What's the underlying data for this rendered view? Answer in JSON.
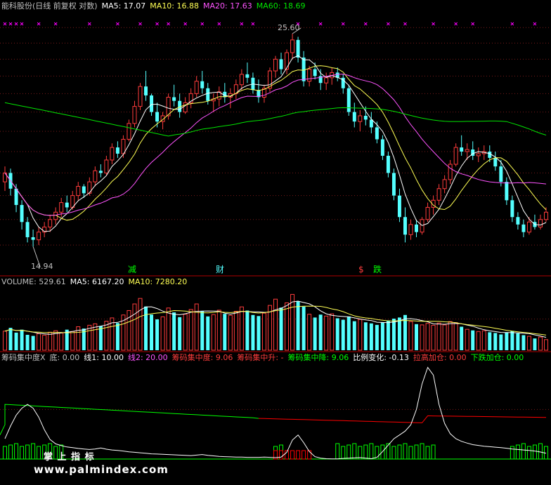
{
  "header": {
    "main": {
      "stock": "能科股份(日线 前复权 对数)",
      "ma5": "MA5: 17.07",
      "ma10": "MA10: 16.88",
      "ma20": "MA20: 17.63",
      "ma60": "MA60: 18.69"
    },
    "volume": {
      "vol": "VOLUME: 529.61",
      "ma5": "MA5: 6167.20",
      "ma10": "MA10: 7280.20"
    },
    "indicator": {
      "name": "筹码集中度X",
      "di": "底: 0.00",
      "xian1": "线1: 10.00",
      "xian2": "线2: 20.00",
      "cmjzd": "筹码集中度: 9.06",
      "rise": "筹码集中升: -",
      "fall": "筹码集中降: 9.06",
      "ratio": "比例变化: -0.13",
      "lagao": "拉高加仓: 0.00",
      "xiadie": "下跌加仓: 0.00"
    }
  },
  "annotations": {
    "high": "25.60",
    "low": "14.94",
    "jian": "减",
    "cai": "财",
    "dollar": "$",
    "die": "跌"
  },
  "watermark": {
    "title": "掌 上 指 标",
    "url": "www.palmindex.com"
  },
  "colors": {
    "up": "#ff3c3c",
    "down": "#54ffff",
    "ma5": "#ffffff",
    "ma10": "#ffff54",
    "ma20": "#ff54ff",
    "ma60": "#00e600",
    "indicator_line": "#ffffff",
    "ind_green": "#00ff00",
    "ind_red": "#ff0000"
  },
  "chart_data": [
    {
      "type": "candlestick",
      "scale": "log",
      "ylim": [
        14.0,
        27.0
      ],
      "high_label": 25.6,
      "low_label": 14.94,
      "bars": [
        [
          17.6,
          18.3,
          17.2,
          18.0
        ],
        [
          18.0,
          18.2,
          17.0,
          17.3
        ],
        [
          17.3,
          17.5,
          16.3,
          16.6
        ],
        [
          16.6,
          16.8,
          15.6,
          15.9
        ],
        [
          15.9,
          16.1,
          15.1,
          15.3
        ],
        [
          15.3,
          15.6,
          14.94,
          15.2
        ],
        [
          15.2,
          15.7,
          15.0,
          15.5
        ],
        [
          15.5,
          15.9,
          15.3,
          15.7
        ],
        [
          15.7,
          16.2,
          15.5,
          16.0
        ],
        [
          16.0,
          16.5,
          15.8,
          16.3
        ],
        [
          16.3,
          16.9,
          16.1,
          16.7
        ],
        [
          16.7,
          17.0,
          16.3,
          16.5
        ],
        [
          16.5,
          17.2,
          16.4,
          17.0
        ],
        [
          17.0,
          17.6,
          16.8,
          17.4
        ],
        [
          17.4,
          17.5,
          16.9,
          17.1
        ],
        [
          17.1,
          17.8,
          17.0,
          17.6
        ],
        [
          17.6,
          18.3,
          17.4,
          18.1
        ],
        [
          18.1,
          18.4,
          17.8,
          18.0
        ],
        [
          18.0,
          18.8,
          17.9,
          18.6
        ],
        [
          18.6,
          19.4,
          18.4,
          19.2
        ],
        [
          19.2,
          19.5,
          18.7,
          18.9
        ],
        [
          18.9,
          19.8,
          18.7,
          19.6
        ],
        [
          19.6,
          20.6,
          19.5,
          20.4
        ],
        [
          20.4,
          21.6,
          20.2,
          21.3
        ],
        [
          21.3,
          22.6,
          21.1,
          22.4
        ],
        [
          22.4,
          23.3,
          21.6,
          21.9
        ],
        [
          21.9,
          22.0,
          20.8,
          21.0
        ],
        [
          21.0,
          21.5,
          20.2,
          20.5
        ],
        [
          20.5,
          21.0,
          20.1,
          20.8
        ],
        [
          20.8,
          22.0,
          20.6,
          21.8
        ],
        [
          21.8,
          22.5,
          21.3,
          21.6
        ],
        [
          21.6,
          22.0,
          20.7,
          21.0
        ],
        [
          21.0,
          21.8,
          20.9,
          21.5
        ],
        [
          21.5,
          22.3,
          21.2,
          22.0
        ],
        [
          22.0,
          23.0,
          21.8,
          22.7
        ],
        [
          22.7,
          23.3,
          22.0,
          22.3
        ],
        [
          22.3,
          22.6,
          21.4,
          21.6
        ],
        [
          21.6,
          22.0,
          21.0,
          21.7
        ],
        [
          21.7,
          22.4,
          21.3,
          22.1
        ],
        [
          22.1,
          22.6,
          21.5,
          21.8
        ],
        [
          21.8,
          22.3,
          21.2,
          22.0
        ],
        [
          22.0,
          22.8,
          21.7,
          22.5
        ],
        [
          22.5,
          23.4,
          22.2,
          23.1
        ],
        [
          23.1,
          23.8,
          22.6,
          22.9
        ],
        [
          22.9,
          23.2,
          22.0,
          22.2
        ],
        [
          22.2,
          22.8,
          21.5,
          21.8
        ],
        [
          21.8,
          22.5,
          21.5,
          22.3
        ],
        [
          22.3,
          23.5,
          22.1,
          23.3
        ],
        [
          23.3,
          24.2,
          22.9,
          24.0
        ],
        [
          24.0,
          24.4,
          23.1,
          23.4
        ],
        [
          23.4,
          24.6,
          23.1,
          24.4
        ],
        [
          24.4,
          25.6,
          24.0,
          25.2
        ],
        [
          25.2,
          25.4,
          23.8,
          24.1
        ],
        [
          24.1,
          24.5,
          22.4,
          22.7
        ],
        [
          22.7,
          23.6,
          22.4,
          23.4
        ],
        [
          23.4,
          23.8,
          22.8,
          23.0
        ],
        [
          23.0,
          23.4,
          22.2,
          22.6
        ],
        [
          22.6,
          23.2,
          22.2,
          22.9
        ],
        [
          22.9,
          23.5,
          22.5,
          23.2
        ],
        [
          23.2,
          23.5,
          22.7,
          22.9
        ],
        [
          22.9,
          23.1,
          22.0,
          22.3
        ],
        [
          22.3,
          22.5,
          20.8,
          21.0
        ],
        [
          21.0,
          21.5,
          20.2,
          20.5
        ],
        [
          20.5,
          21.1,
          20.0,
          20.8
        ],
        [
          20.8,
          21.3,
          20.3,
          20.6
        ],
        [
          20.6,
          21.0,
          19.9,
          20.2
        ],
        [
          20.2,
          20.5,
          19.4,
          19.6
        ],
        [
          19.6,
          19.8,
          18.6,
          18.8
        ],
        [
          18.8,
          19.0,
          17.8,
          18.0
        ],
        [
          18.0,
          18.2,
          16.8,
          17.0
        ],
        [
          17.0,
          17.3,
          15.9,
          16.1
        ],
        [
          16.1,
          16.5,
          15.1,
          15.4
        ],
        [
          15.4,
          16.0,
          15.2,
          15.8
        ],
        [
          15.8,
          16.0,
          15.3,
          15.5
        ],
        [
          15.5,
          16.1,
          15.4,
          16.0
        ],
        [
          16.0,
          16.7,
          15.9,
          16.5
        ],
        [
          16.5,
          17.0,
          16.2,
          16.8
        ],
        [
          16.8,
          17.5,
          16.6,
          17.3
        ],
        [
          17.3,
          17.9,
          17.1,
          17.7
        ],
        [
          17.7,
          18.6,
          17.5,
          18.4
        ],
        [
          18.4,
          19.4,
          18.3,
          19.2
        ],
        [
          19.2,
          19.8,
          18.8,
          19.0
        ],
        [
          19.0,
          19.4,
          18.6,
          19.1
        ],
        [
          19.1,
          19.5,
          18.6,
          18.8
        ],
        [
          18.8,
          19.2,
          18.5,
          18.9
        ],
        [
          18.9,
          19.3,
          18.6,
          19.0
        ],
        [
          19.0,
          19.3,
          18.5,
          18.7
        ],
        [
          18.7,
          19.0,
          18.1,
          18.3
        ],
        [
          18.3,
          18.6,
          17.4,
          17.6
        ],
        [
          17.6,
          17.8,
          16.6,
          16.8
        ],
        [
          16.8,
          17.0,
          15.9,
          16.1
        ],
        [
          16.1,
          16.3,
          15.6,
          15.8
        ],
        [
          15.8,
          16.0,
          15.3,
          15.5
        ],
        [
          15.5,
          16.1,
          15.4,
          15.9
        ],
        [
          15.9,
          16.2,
          15.6,
          15.7
        ],
        [
          15.7,
          16.2,
          15.6,
          16.0
        ],
        [
          16.0,
          16.5,
          15.9,
          16.3
        ]
      ],
      "ma5": "MA5",
      "ma10": "MA10",
      "ma20": "MA20",
      "ma60": "MA60"
    },
    {
      "type": "bar",
      "series": "VOLUME",
      "values": [
        5200,
        6100,
        4800,
        5600,
        4200,
        3900,
        4500,
        4100,
        4900,
        5300,
        4700,
        5600,
        5100,
        6400,
        5900,
        6800,
        7200,
        6600,
        7900,
        8800,
        7400,
        9600,
        10800,
        12600,
        14100,
        11900,
        9700,
        8400,
        9100,
        11500,
        10300,
        9000,
        9800,
        11100,
        12600,
        10700,
        9200,
        9700,
        10900,
        9900,
        9500,
        10600,
        11800,
        10800,
        9600,
        9300,
        10100,
        12200,
        13900,
        11600,
        12900,
        15200,
        13300,
        11900,
        9800,
        8900,
        9700,
        9300,
        9900,
        8700,
        8300,
        9200,
        7900,
        8400,
        7600,
        7300,
        6900,
        7600,
        8100,
        8600,
        8900,
        9600,
        7800,
        7100,
        6900,
        7300,
        6800,
        7400,
        6900,
        7800,
        7500,
        6400,
        5700,
        5400,
        5100,
        5300,
        4900,
        4700,
        4300,
        4900,
        5200,
        4600,
        4100,
        3800,
        3200,
        3600,
        2900
      ],
      "ylim": [
        0,
        17000
      ]
    },
    {
      "type": "line",
      "series_line": "筹码集中度",
      "values": [
        8.5,
        13.5,
        17.8,
        20.5,
        22.0,
        20.5,
        17.0,
        12.0,
        8.2,
        6.5,
        5.8,
        5.3,
        5.0,
        4.7,
        4.5,
        4.3,
        4.5,
        4.9,
        4.4,
        4.1,
        3.9,
        3.7,
        3.4,
        3.2,
        3.0,
        2.8,
        2.6,
        2.5,
        2.4,
        2.3,
        2.2,
        2.1,
        2.0,
        1.9,
        2.1,
        2.3,
        2.0,
        1.8,
        1.6,
        1.5,
        1.4,
        1.3,
        1.3,
        1.2,
        1.2,
        1.2,
        1.3,
        1.2,
        1.1,
        1.3,
        3.2,
        8.0,
        10.0,
        7.0,
        3.5,
        1.5,
        0.9,
        0.7,
        0.6,
        0.6,
        0.8,
        0.9,
        1.0,
        1.1,
        0.9,
        0.7,
        1.2,
        3.5,
        6.0,
        8.5,
        10.0,
        11.5,
        14.0,
        20.0,
        30.0,
        36.5,
        33.5,
        22.0,
        14.5,
        10.5,
        8.5,
        7.5,
        6.8,
        6.2,
        5.9,
        5.6,
        5.4,
        5.2,
        5.0,
        4.8,
        4.5,
        4.3,
        4.1,
        3.9,
        3.7,
        3.3,
        2.8
      ],
      "green_bars": [
        0,
        1,
        2,
        3,
        4,
        5,
        6,
        7,
        8,
        9,
        10,
        48,
        49,
        59,
        60,
        61,
        62,
        63,
        64,
        65,
        66,
        67,
        68,
        69,
        70,
        71,
        72,
        73,
        74,
        75,
        76,
        90,
        91,
        92,
        93,
        94,
        95,
        96
      ],
      "red_bars": [
        48,
        49,
        50,
        51,
        52,
        53,
        54
      ],
      "ylim": [
        0,
        38
      ]
    }
  ]
}
